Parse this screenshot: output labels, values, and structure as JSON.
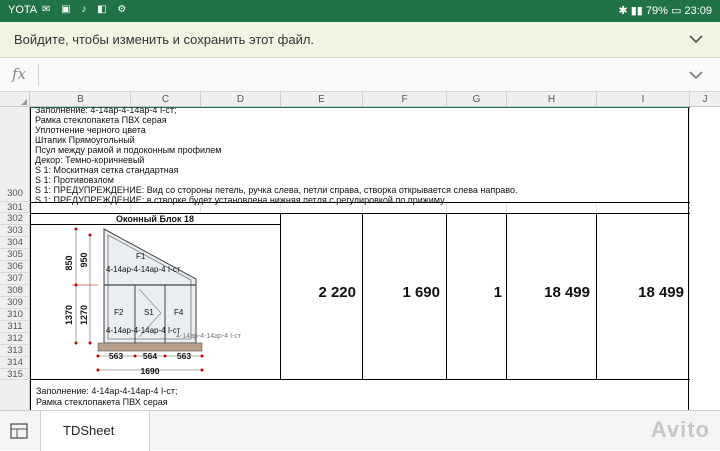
{
  "status_bar": {
    "carrier": "YOTA",
    "battery": "79%",
    "time": "23:09"
  },
  "banner": {
    "message": "Войдите, чтобы изменить и сохранить этот файл."
  },
  "formula_bar": {
    "fx_label": "fx",
    "value": ""
  },
  "columns": [
    "B",
    "C",
    "D",
    "E",
    "F",
    "G",
    "H",
    "I",
    "J"
  ],
  "rows": [
    "300",
    "301",
    "302",
    "303",
    "304",
    "305",
    "306",
    "307",
    "308",
    "309",
    "310",
    "311",
    "312",
    "313",
    "314",
    "315"
  ],
  "spec_lines": [
    "Заполнение: 4-14ар-4-14ар-4 I-ст;",
    "Рамка стеклопакета ПВХ серая",
    "Уплотнение черного цвета",
    "Штапик Прямоугольный",
    "Псул между рамой и подоконным профилем",
    "Декор: Темно-коричневый",
    "S 1: Москитная сетка стандартная",
    "S 1: Противовзлом",
    "S 1: ПРЕДУПРЕЖДЕНИЕ: Вид со стороны петель, ручка слева, петли справа, створка открывается слева направо.",
    "S 1: ПРЕДУПРЕЖДЕНИЕ: в створке будет установлена нижняя петля с регулировкой по прижиму"
  ],
  "block": {
    "title": "Оконный Блок 18",
    "values": {
      "e": "2 220",
      "f": "1 690",
      "g": "1",
      "h": "18 499",
      "i": "18 499"
    },
    "drawing": {
      "dims_left": [
        "850",
        "950",
        "1370",
        "1270"
      ],
      "dims_bottom": [
        "563",
        "564",
        "563"
      ],
      "total_width": "1690",
      "top_glass": "4-14ар-4-14ар-4 I-ст",
      "bottom_glass": "4-14ар-4-14ар-4 I-ст",
      "panes": [
        "F1",
        "F2",
        "S1",
        "F4"
      ]
    }
  },
  "next_lines": [
    "Заполнение: 4-14ар-4-14ар-4 I-ст;",
    "Рамка стеклопакета ПВХ серая"
  ],
  "sheet_tab": "TDSheet",
  "watermark": "Avito"
}
